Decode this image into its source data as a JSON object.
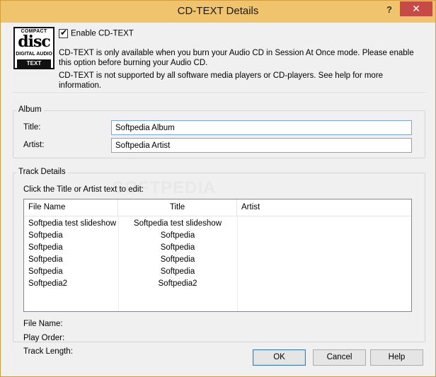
{
  "window": {
    "title": "CD-TEXT Details",
    "help_glyph": "?",
    "close_glyph": "✕"
  },
  "logo": {
    "line1": "COMPACT",
    "line2": "disc",
    "line3": "DIGITAL AUDIO",
    "line4": "TEXT"
  },
  "enable": {
    "label": "Enable CD-TEXT",
    "checked": true,
    "check_glyph": "✔"
  },
  "info": {
    "line1": "CD-TEXT is only available when you burn your Audio CD in Session At Once mode.  Please enable this option before burning your Audio CD.",
    "line2": "CD-TEXT is not supported by all software media players or CD-players.  See help for more information."
  },
  "album": {
    "group_label": "Album",
    "title_label": "Title:",
    "title_value": "Softpedia Album",
    "artist_label": "Artist:",
    "artist_value": "Softpedia Artist"
  },
  "tracks": {
    "group_label": "Track Details",
    "hint": "Click the Title or Artist text to edit:",
    "watermark": "SOFTPEDIA",
    "columns": [
      "File Name",
      "Title",
      "Artist"
    ],
    "rows": [
      {
        "file": "Softpedia test slideshow",
        "title": "Softpedia test slideshow",
        "artist": ""
      },
      {
        "file": "Softpedia",
        "title": "Softpedia",
        "artist": ""
      },
      {
        "file": "Softpedia",
        "title": "Softpedia",
        "artist": ""
      },
      {
        "file": "Softpedia",
        "title": "Softpedia",
        "artist": ""
      },
      {
        "file": "Softpedia",
        "title": "Softpedia",
        "artist": ""
      },
      {
        "file": "Softpedia2",
        "title": "Softpedia2",
        "artist": ""
      }
    ],
    "file_name_label": "File Name:",
    "play_order_label": "Play Order:",
    "track_length_label": "Track Length:"
  },
  "buttons": {
    "ok": "OK",
    "cancel": "Cancel",
    "help": "Help"
  },
  "colors": {
    "titlebar": "#f0c46c",
    "close": "#c74a46",
    "input_border": "#7aa7d8"
  }
}
